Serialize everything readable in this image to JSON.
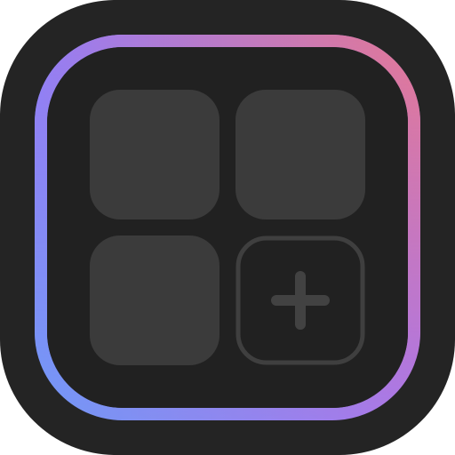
{
  "icon": {
    "name": "widget-grid-app-icon",
    "colors": {
      "outer_background": "#242424",
      "inner_background": "#212121",
      "tile_fill": "#3b3b3b",
      "add_tile_border": "#3f3f3f",
      "plus_color": "#424242",
      "ring_gradient_top_left": "#9b79f2",
      "ring_gradient_top_right": "#e8788d",
      "ring_gradient_bottom_left": "#6f9bf8",
      "ring_gradient_bottom_right": "#a777ef"
    },
    "tiles": [
      {
        "name": "widget-tile-top-left",
        "kind": "filled"
      },
      {
        "name": "widget-tile-top-right",
        "kind": "filled"
      },
      {
        "name": "widget-tile-bottom-left",
        "kind": "filled"
      },
      {
        "name": "add-widget-tile",
        "kind": "outlined-plus"
      }
    ]
  }
}
